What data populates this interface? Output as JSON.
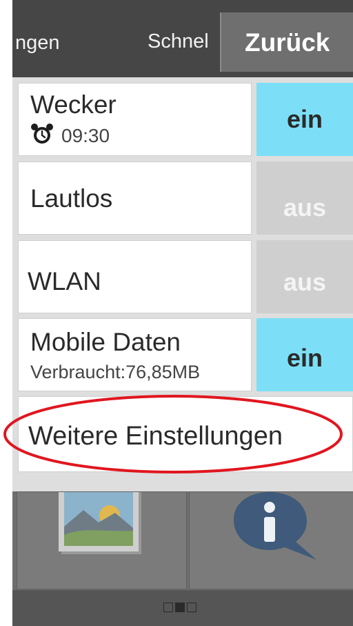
{
  "titlebar": {
    "tab_left_partial": "ngen",
    "tab_middle_partial": "Schnel",
    "back_button": "Zurück"
  },
  "settings": [
    {
      "label": "Wecker",
      "sub": "09:30",
      "sub_icon": "alarm-clock-icon",
      "state": "ein",
      "on": true
    },
    {
      "label": "Lautlos",
      "state": "aus",
      "on": false
    },
    {
      "label": "WLAN",
      "state": "aus",
      "on": false
    },
    {
      "label": "Mobile Daten",
      "sub": "Verbraucht:76,85MB",
      "state": "ein",
      "on": true
    }
  ],
  "more_settings": "Weitere Einstellungen",
  "home": {
    "tiles": [
      "gallery-icon",
      "info-icon"
    ],
    "page_indicator": {
      "pages": 3,
      "current": 2
    }
  },
  "colors": {
    "toggle_on": "#7ddff7",
    "toggle_off": "#cfcfcf",
    "highlight_ellipse": "#e0161f",
    "titlebar": "#464646"
  }
}
